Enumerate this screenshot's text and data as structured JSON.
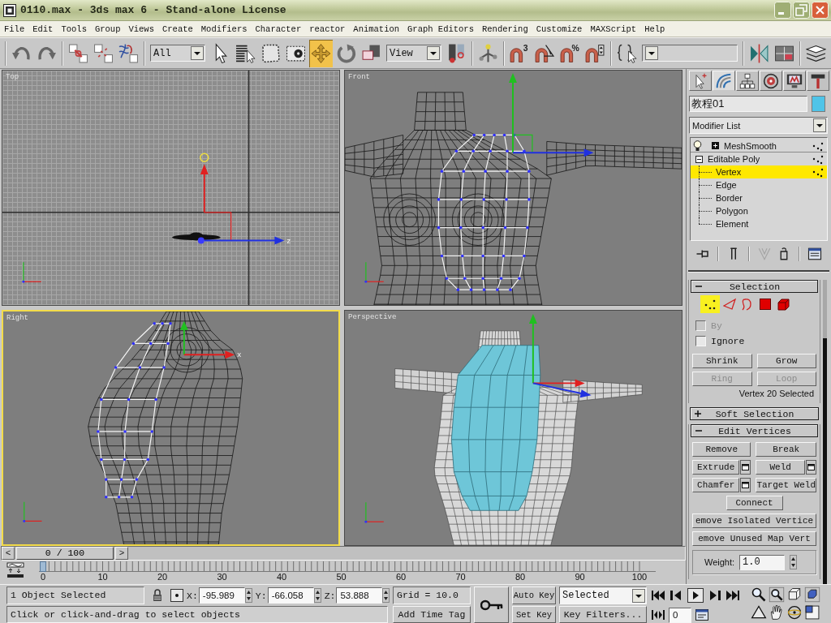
{
  "window": {
    "title": "0110.max - 3ds max 6 - Stand-alone License"
  },
  "menu": [
    "File",
    "Edit",
    "Tools",
    "Group",
    "Views",
    "Create",
    "Modifiers",
    "Character",
    "reactor",
    "Animation",
    "Graph Editors",
    "Rendering",
    "Customize",
    "MAXScript",
    "Help"
  ],
  "toolbar": {
    "groups": [
      [
        {
          "kind": "undo",
          "selected": false
        },
        {
          "kind": "redo",
          "selected": false
        }
      ],
      [
        {
          "kind": "link",
          "selected": false
        },
        {
          "kind": "unlink",
          "selected": false
        },
        {
          "kind": "bind",
          "selected": false
        }
      ],
      [
        {
          "kind": "dropdown",
          "value": "All"
        },
        {
          "kind": "select",
          "selected": false
        },
        {
          "kind": "select_by_name",
          "selected": false
        },
        {
          "kind": "region",
          "selected": false
        },
        {
          "kind": "crossing",
          "selected": false
        },
        {
          "kind": "move",
          "selected": true
        },
        {
          "kind": "rotate",
          "selected": false
        },
        {
          "kind": "scale",
          "selected": false
        },
        {
          "kind": "dropdown",
          "value": "View"
        },
        {
          "kind": "pivot",
          "selected": false
        }
      ],
      [
        {
          "kind": "manipulate",
          "selected": false
        }
      ],
      [
        {
          "kind": "snap",
          "selected": false,
          "glyph": "3"
        },
        {
          "kind": "angle_snap",
          "selected": false
        },
        {
          "kind": "percent_snap",
          "selected": false,
          "glyph": "%"
        },
        {
          "kind": "spinner_snap",
          "selected": false
        }
      ],
      [
        {
          "kind": "named_sets",
          "selected": false
        },
        {
          "kind": "dropdown"
        }
      ],
      [
        {
          "kind": "mirror",
          "selected": false
        },
        {
          "kind": "align",
          "selected": false
        }
      ],
      [
        {
          "kind": "layers",
          "selected": false
        }
      ]
    ]
  },
  "viewports": [
    {
      "label": "Top",
      "kind": "top",
      "selected": false,
      "axis_label": "z"
    },
    {
      "label": "Front",
      "kind": "front",
      "selected": false
    },
    {
      "label": "Right",
      "kind": "side",
      "selected": true,
      "axis_label": "x"
    },
    {
      "label": "Perspective",
      "kind": "perspective",
      "selected": false
    }
  ],
  "time_slider": {
    "prev": "<",
    "value": "0 / 100",
    "next": ">",
    "level": 0
  },
  "track_bar": {
    "ticks": [
      "0",
      "10",
      "20",
      "30",
      "40",
      "50",
      "60",
      "70",
      "80",
      "90",
      "100"
    ]
  },
  "command_panel": {
    "tabs": [
      {
        "kind": "create",
        "selected": false
      },
      {
        "kind": "modify",
        "selected": true
      },
      {
        "kind": "hierarchy",
        "selected": false
      },
      {
        "kind": "motion",
        "selected": false
      },
      {
        "kind": "display",
        "selected": false
      },
      {
        "kind": "utilities",
        "selected": false
      }
    ],
    "object_name": "教程01",
    "modifier_list": "Modifier List",
    "stack": [
      {
        "kind": "modifier",
        "label": "MeshSmooth",
        "on": true,
        "expanded": false
      },
      {
        "kind": "object",
        "label": "Editable Poly",
        "expanded": true,
        "children": [
          {
            "label": "Vertex",
            "selected": true
          },
          {
            "label": "Edge",
            "selected": false
          },
          {
            "label": "Border",
            "selected": false
          },
          {
            "label": "Polygon",
            "selected": false
          },
          {
            "label": "Element",
            "selected": false
          }
        ]
      }
    ],
    "stack_tools": [
      [
        {
          "kind": "pin",
          "disabled": false
        }
      ],
      [
        {
          "kind": "end_result",
          "disabled": false
        }
      ],
      [
        {
          "kind": "make_unique",
          "disabled": true
        },
        {
          "kind": "remove",
          "disabled": false
        }
      ],
      [
        {
          "kind": "configure",
          "disabled": false
        }
      ]
    ],
    "rollouts": [
      {
        "kind": "selection",
        "title": "Selection",
        "expanded": true,
        "modes": [
          {
            "kind": "vertex",
            "selected": true
          },
          {
            "kind": "edge",
            "selected": false
          },
          {
            "kind": "border",
            "selected": false
          },
          {
            "kind": "polygon",
            "selected": false
          },
          {
            "kind": "element",
            "selected": false
          }
        ],
        "checkboxes": [
          {
            "label": "By",
            "checked": false,
            "disabled": true
          },
          {
            "label": "Ignore",
            "checked": false,
            "disabled": false
          }
        ],
        "buttons": [
          {
            "label": "Shrink",
            "disabled": false
          },
          {
            "label": "Grow",
            "disabled": false
          },
          {
            "label": "Ring",
            "disabled": true
          },
          {
            "label": "Loop",
            "disabled": true
          }
        ],
        "status": "Vertex 20 Selected"
      },
      {
        "kind": "soft_selection",
        "title": "Soft Selection",
        "expanded": false
      },
      {
        "kind": "edit_vertices",
        "title": "Edit Vertices",
        "expanded": true,
        "button_rows": [
          {
            "kind": "pair",
            "buttons": [
              {
                "label": "Remove",
                "settings": false
              },
              {
                "label": "Break",
                "settings": false
              }
            ]
          },
          {
            "kind": "pair",
            "buttons": [
              {
                "label": "Extrude",
                "settings": true
              },
              {
                "label": "Weld",
                "settings": true
              }
            ]
          },
          {
            "kind": "pair",
            "buttons": [
              {
                "label": "Chamfer",
                "settings": true
              },
              {
                "label": "Target Weld",
                "settings": false
              }
            ]
          },
          {
            "kind": "center",
            "buttons": [
              {
                "label": "Connect",
                "settings": false
              }
            ]
          },
          {
            "kind": "full",
            "buttons": [
              {
                "label": "emove Isolated Vertice",
                "settings": false
              }
            ]
          },
          {
            "kind": "full",
            "buttons": [
              {
                "label": "emove Unused Map Vert",
                "settings": false
              }
            ]
          }
        ],
        "weight": {
          "label": "Weight:",
          "value": "1.0"
        }
      }
    ]
  },
  "status_bar": {
    "selection": "1 Object Selected",
    "coords": [
      {
        "axis": "X:",
        "value": "-95.989"
      },
      {
        "axis": "Y:",
        "value": "-66.058"
      },
      {
        "axis": "Z:",
        "value": "53.888"
      }
    ],
    "grid": "Grid = 10.0",
    "prompt": "Click or click-and-drag to select objects",
    "time_tag": "Add Time Tag"
  },
  "animation_controls": {
    "auto_key": "Auto Key",
    "key_mode": "Selected",
    "set_key": "Set Key",
    "key_filters": "Key Filters...",
    "frame": "0"
  }
}
